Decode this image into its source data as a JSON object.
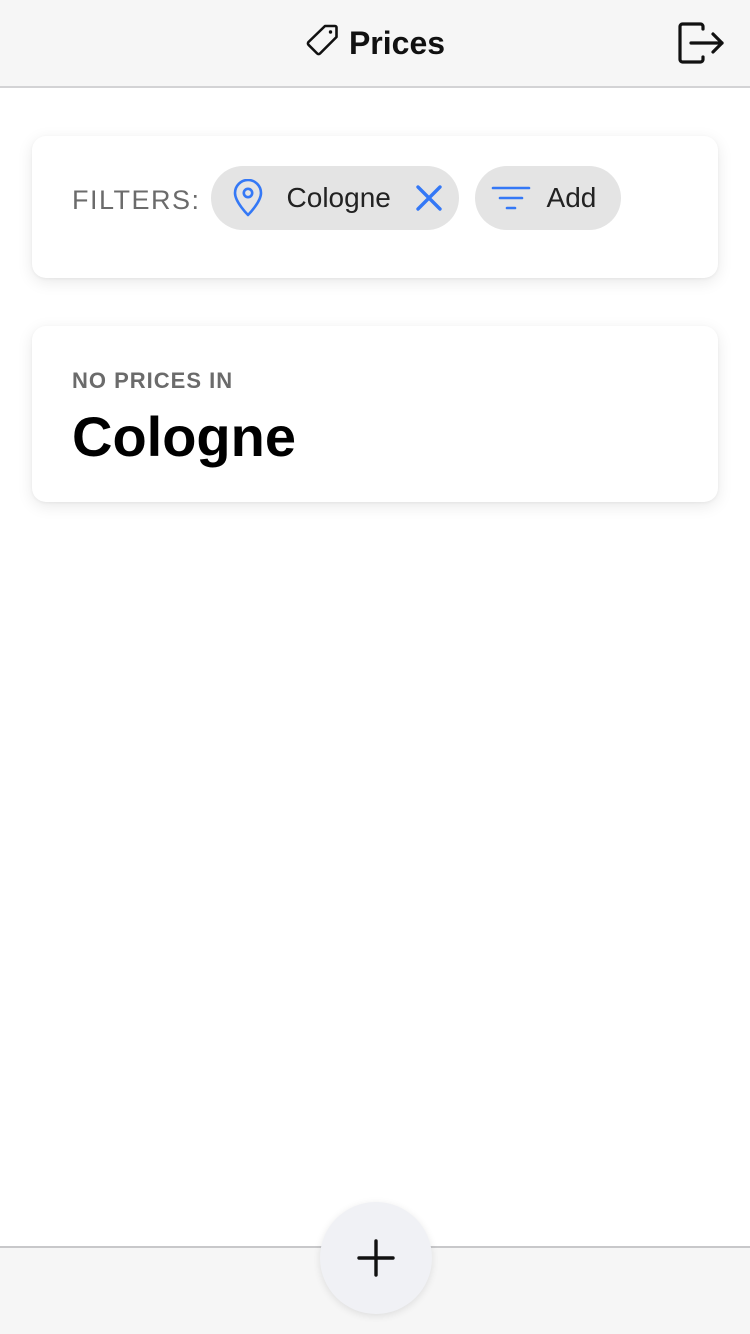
{
  "header": {
    "title": "Prices",
    "title_icon": "tag-icon",
    "logout_icon": "logout-icon"
  },
  "filters": {
    "label": "FILTERS:",
    "chips": [
      {
        "icon": "map-pin-icon",
        "label": "Cologne",
        "remove_icon": "close-icon"
      },
      {
        "icon": "filter-icon",
        "label": "Add"
      }
    ]
  },
  "result": {
    "caption": "NO PRICES IN",
    "city": "Cologne"
  },
  "fab": {
    "icon": "plus-icon"
  },
  "colors": {
    "accent": "#3478f6",
    "header_bg": "#f6f6f6",
    "chip_bg": "#e4e4e4",
    "muted_text": "#6b6b6b"
  }
}
